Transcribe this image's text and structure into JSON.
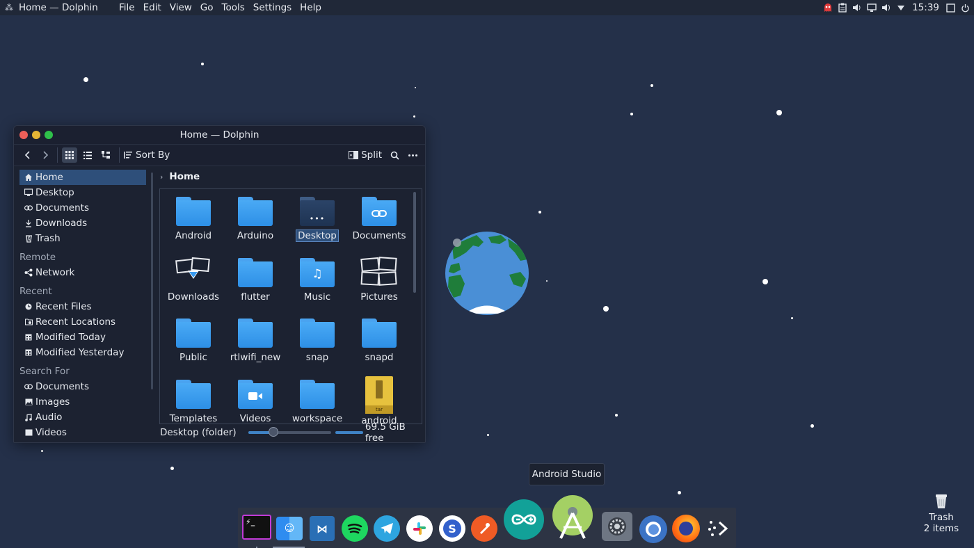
{
  "topbar": {
    "app_title": "Home — Dolphin",
    "menu": [
      "File",
      "Edit",
      "View",
      "Go",
      "Tools",
      "Settings",
      "Help"
    ],
    "clock": "15:39"
  },
  "window": {
    "title": "Home — Dolphin",
    "toolbar": {
      "sort_label": "Sort By",
      "split_label": "Split"
    },
    "sidebar": {
      "places": [
        {
          "label": "Home",
          "icon": "home-icon"
        },
        {
          "label": "Desktop",
          "icon": "desktop-icon"
        },
        {
          "label": "Documents",
          "icon": "documents-icon"
        },
        {
          "label": "Downloads",
          "icon": "downloads-icon"
        },
        {
          "label": "Trash",
          "icon": "trash-icon"
        }
      ],
      "remote_heading": "Remote",
      "remote": [
        {
          "label": "Network",
          "icon": "network-icon"
        }
      ],
      "recent_heading": "Recent",
      "recent": [
        {
          "label": "Recent Files",
          "icon": "clock-icon"
        },
        {
          "label": "Recent Locations",
          "icon": "folder-clock-icon"
        },
        {
          "label": "Modified Today",
          "icon": "calendar-icon"
        },
        {
          "label": "Modified Yesterday",
          "icon": "calendar-icon"
        }
      ],
      "search_heading": "Search For",
      "search": [
        {
          "label": "Documents",
          "icon": "documents-icon"
        },
        {
          "label": "Images",
          "icon": "image-icon"
        },
        {
          "label": "Audio",
          "icon": "music-note-icon"
        },
        {
          "label": "Videos",
          "icon": "video-icon"
        }
      ]
    },
    "breadcrumb": "Home",
    "files": [
      {
        "name": "Android",
        "type": "folder"
      },
      {
        "name": "Arduino",
        "type": "folder"
      },
      {
        "name": "Desktop",
        "type": "folder-desktop",
        "selected": true
      },
      {
        "name": "Documents",
        "type": "folder-documents"
      },
      {
        "name": "Downloads",
        "type": "folder-downloads"
      },
      {
        "name": "flutter",
        "type": "folder"
      },
      {
        "name": "Music",
        "type": "folder-music"
      },
      {
        "name": "Pictures",
        "type": "folder-pictures"
      },
      {
        "name": "Public",
        "type": "folder"
      },
      {
        "name": "rtlwifi_new",
        "type": "folder"
      },
      {
        "name": "snap",
        "type": "folder"
      },
      {
        "name": "snapd",
        "type": "folder"
      },
      {
        "name": "Templates",
        "type": "folder"
      },
      {
        "name": "Videos",
        "type": "folder-videos"
      },
      {
        "name": "workspace",
        "type": "folder"
      },
      {
        "name": "android",
        "type": "archive-tar"
      }
    ],
    "archive_badge": "tar",
    "status": {
      "text": "Desktop (folder)",
      "free_space": "69.5 GiB free",
      "zoom_level": 0.3
    }
  },
  "tooltip": "Android Studio",
  "dock": {
    "apps": [
      "terminal",
      "finder",
      "visual-studio-code",
      "spotify",
      "telegram",
      "slack",
      "simplenote",
      "postman",
      "arduino",
      "android-studio",
      "system-preferences",
      "chromium",
      "firefox",
      "launchpad"
    ]
  },
  "desktop": {
    "trash_label": "Trash",
    "trash_count": "2 items"
  },
  "colors": {
    "desktop_bg": "#243049",
    "accent": "#2e4f7a",
    "folder_blue": "#3a9bef"
  }
}
